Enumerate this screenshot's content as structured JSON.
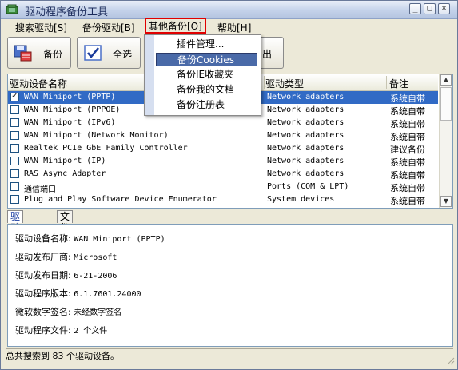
{
  "window": {
    "title": "驱动程序备份工具",
    "controls": [
      "_",
      "□",
      "×"
    ]
  },
  "menu": [
    {
      "label": "搜索驱动[S]"
    },
    {
      "label": "备份驱动[B]"
    },
    {
      "label": "其他备份[O]"
    },
    {
      "label": "帮助[H]"
    }
  ],
  "toolbar": {
    "backup_label": "备份",
    "selectall_label": "全选",
    "exit_partial": "出"
  },
  "dropdown": [
    {
      "label": "插件管理..."
    },
    {
      "label": "备份Cookies"
    },
    {
      "label": "备份IE收藏夹"
    },
    {
      "label": "备份我的文档"
    },
    {
      "label": "备份注册表"
    }
  ],
  "list": {
    "headers": [
      "驱动设备名称",
      "驱动类型",
      "备注"
    ],
    "rows": [
      {
        "checked": true,
        "name": "WAN Miniport (PPTP)",
        "type": "Network adapters",
        "note": "系统自带"
      },
      {
        "checked": false,
        "name": "WAN Miniport (PPPOE)",
        "type": "Network adapters",
        "note": "系统自带"
      },
      {
        "checked": false,
        "name": "WAN Miniport (IPv6)",
        "type": "Network adapters",
        "note": "系统自带"
      },
      {
        "checked": false,
        "name": "WAN Miniport (Network Monitor)",
        "type": "Network adapters",
        "note": "系统自带"
      },
      {
        "checked": false,
        "name": "Realtek PCIe GbE Family Controller",
        "type": "Network adapters",
        "note": "建议备份"
      },
      {
        "checked": false,
        "name": "WAN Miniport (IP)",
        "type": "Network adapters",
        "note": "系统自带"
      },
      {
        "checked": false,
        "name": "RAS Async Adapter",
        "type": "Network adapters",
        "note": "系统自带"
      },
      {
        "checked": false,
        "name": "通信端口",
        "type": "Ports (COM & LPT)",
        "note": "系统自带"
      },
      {
        "checked": false,
        "name": "Plug and Play Software Device Enumerator",
        "type": "System devices",
        "note": "系统自带"
      }
    ]
  },
  "tabs": [
    {
      "label": "驱动摘要"
    },
    {
      "label": "文件列表"
    }
  ],
  "summary": [
    {
      "label": "驱动设备名称:",
      "value": "WAN Miniport (PPTP)"
    },
    {
      "label": "驱动发布厂商:",
      "value": "Microsoft"
    },
    {
      "label": "驱动发布日期:",
      "value": "6-21-2006"
    },
    {
      "label": "驱动程序版本:",
      "value": "6.1.7601.24000"
    },
    {
      "label": "微软数字签名:",
      "value": "未经数字签名"
    },
    {
      "label": "驱动程序文件:",
      "value": "2 个文件"
    }
  ],
  "status": {
    "text": "总共搜索到 83 个驱动设备。"
  }
}
